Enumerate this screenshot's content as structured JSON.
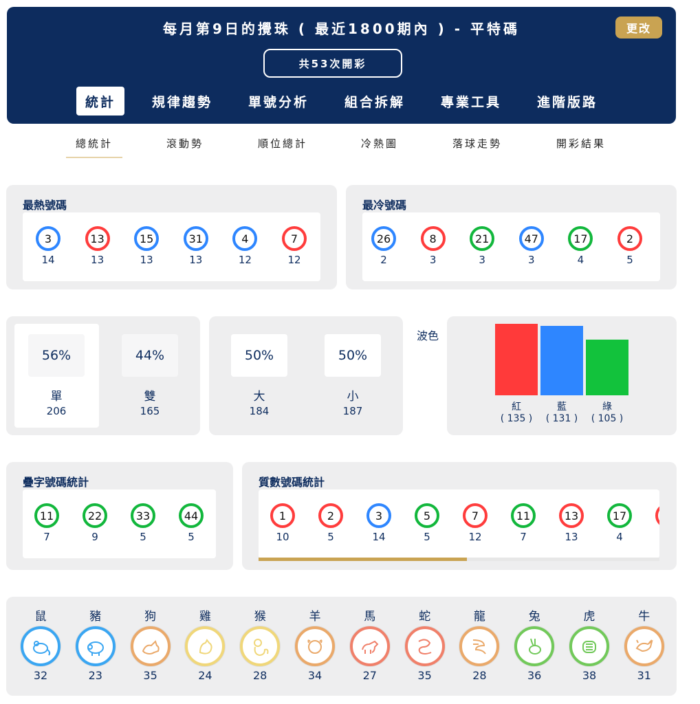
{
  "header": {
    "title": "每月第9日的攪珠 ( 最近1800期內 ) - 平特碼",
    "change_label": "更改",
    "count_label": "共53次開彩",
    "tabs": [
      "統計",
      "規律趨勢",
      "單號分析",
      "組合拆解",
      "專業工具",
      "進階版路"
    ]
  },
  "sub_tabs": [
    "總統計",
    "滾動勢",
    "順位總計",
    "冷熱圖",
    "落球走勢",
    "開彩結果"
  ],
  "hot": {
    "title": "最熱號碼",
    "balls": [
      {
        "n": "3",
        "c": "14",
        "color": "blue"
      },
      {
        "n": "13",
        "c": "13",
        "color": "red"
      },
      {
        "n": "15",
        "c": "13",
        "color": "blue"
      },
      {
        "n": "31",
        "c": "13",
        "color": "blue"
      },
      {
        "n": "4",
        "c": "12",
        "color": "blue"
      },
      {
        "n": "7",
        "c": "12",
        "color": "red"
      }
    ]
  },
  "cold": {
    "title": "最冷號碼",
    "balls": [
      {
        "n": "26",
        "c": "2",
        "color": "blue"
      },
      {
        "n": "8",
        "c": "3",
        "color": "red"
      },
      {
        "n": "21",
        "c": "3",
        "color": "green"
      },
      {
        "n": "47",
        "c": "3",
        "color": "blue"
      },
      {
        "n": "17",
        "c": "4",
        "color": "green"
      },
      {
        "n": "2",
        "c": "5",
        "color": "red"
      }
    ]
  },
  "odd_even": [
    {
      "pct": "56%",
      "label": "單",
      "num": "206"
    },
    {
      "pct": "44%",
      "label": "雙",
      "num": "165"
    }
  ],
  "big_small": [
    {
      "pct": "50%",
      "label": "大",
      "num": "184"
    },
    {
      "pct": "50%",
      "label": "小",
      "num": "187"
    }
  ],
  "wave": {
    "title": "波色",
    "bars": [
      {
        "label": "紅",
        "count": "( 135 )",
        "value": 135,
        "color": "#ff3a3a"
      },
      {
        "label": "藍",
        "count": "( 131 )",
        "value": 131,
        "color": "#2e86ff"
      },
      {
        "label": "綠",
        "count": "( 105 )",
        "value": 105,
        "color": "#12c23c"
      }
    ]
  },
  "repeat": {
    "title": "疊字號碼統計",
    "balls": [
      {
        "n": "11",
        "c": "7",
        "color": "green"
      },
      {
        "n": "22",
        "c": "9",
        "color": "green"
      },
      {
        "n": "33",
        "c": "5",
        "color": "green"
      },
      {
        "n": "44",
        "c": "5",
        "color": "green"
      }
    ]
  },
  "prime": {
    "title": "質數號碼統計",
    "balls": [
      {
        "n": "1",
        "c": "10",
        "color": "red"
      },
      {
        "n": "2",
        "c": "5",
        "color": "red"
      },
      {
        "n": "3",
        "c": "14",
        "color": "blue"
      },
      {
        "n": "5",
        "c": "5",
        "color": "green"
      },
      {
        "n": "7",
        "c": "12",
        "color": "red"
      },
      {
        "n": "11",
        "c": "7",
        "color": "green"
      },
      {
        "n": "13",
        "c": "13",
        "color": "red"
      },
      {
        "n": "17",
        "c": "4",
        "color": "green"
      }
    ],
    "scroll_fraction": 0.52
  },
  "zodiac": [
    {
      "name": "鼠",
      "count": "32",
      "ring": "#3aa6f2",
      "icon": "rat-icon"
    },
    {
      "name": "豬",
      "count": "23",
      "ring": "#3aa6f2",
      "icon": "pig-icon"
    },
    {
      "name": "狗",
      "count": "35",
      "ring": "#eaa96a",
      "icon": "dog-icon"
    },
    {
      "name": "雞",
      "count": "24",
      "ring": "#f0d77a",
      "icon": "rooster-icon"
    },
    {
      "name": "猴",
      "count": "28",
      "ring": "#f0d77a",
      "icon": "monkey-icon"
    },
    {
      "name": "羊",
      "count": "34",
      "ring": "#eaa96a",
      "icon": "goat-icon"
    },
    {
      "name": "馬",
      "count": "27",
      "ring": "#f0806a",
      "icon": "horse-icon"
    },
    {
      "name": "蛇",
      "count": "35",
      "ring": "#f0806a",
      "icon": "snake-icon"
    },
    {
      "name": "龍",
      "count": "28",
      "ring": "#eaa96a",
      "icon": "dragon-icon"
    },
    {
      "name": "兔",
      "count": "36",
      "ring": "#72c95a",
      "icon": "rabbit-icon"
    },
    {
      "name": "虎",
      "count": "38",
      "ring": "#72c95a",
      "icon": "tiger-icon"
    },
    {
      "name": "牛",
      "count": "31",
      "ring": "#eaa96a",
      "icon": "ox-icon"
    }
  ]
}
